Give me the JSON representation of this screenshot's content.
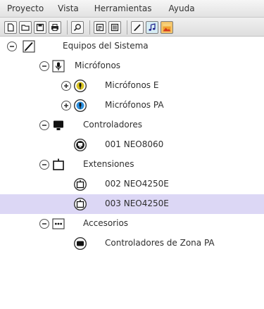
{
  "menu": [
    "Proyecto",
    "Vista",
    "Herramientas",
    "Ayuda"
  ],
  "toolbar": {
    "buttons": [
      "new-file-icon",
      "open-folder-icon",
      "save-icon",
      "print-icon",
      "search-icon",
      "properties-icon",
      "list-icon",
      "pen-icon",
      "music-note-icon",
      "image-icon"
    ]
  },
  "tree": {
    "root": "Equipos del Sistema",
    "microphones": "Micrófonos",
    "microphones_e": "Micrófonos E",
    "microphones_pa": "Micrófonos PA",
    "controllers": "Controladores",
    "controller_1": "001 NEO8060",
    "extensions": "Extensiones",
    "extension_1": "002 NEO4250E",
    "extension_2": "003 NEO4250E",
    "accessories": "Accesorios",
    "zone_controllers": "Controladores de Zona PA"
  },
  "colors": {
    "selected_row": "#dcd7f5",
    "mic_e_accent": "#d9c320",
    "mic_pa_accent": "#2a8fe0"
  }
}
